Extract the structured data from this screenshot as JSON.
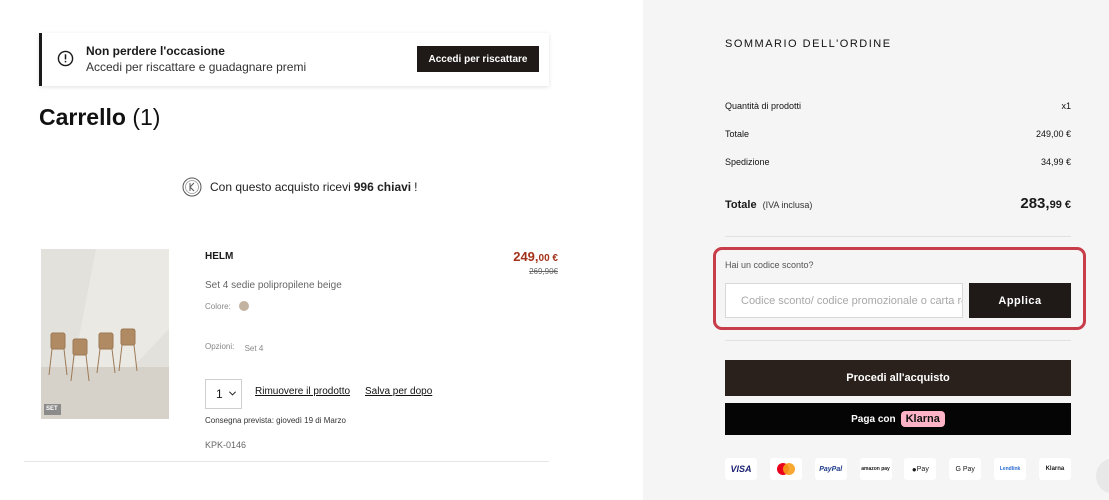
{
  "banner": {
    "title": "Non perdere l'occasione",
    "subtitle": "Accedi per riscattare e guadagnare premi",
    "button": "Accedi per riscattare",
    "icon": "info-icon"
  },
  "cart": {
    "title": "Carrello",
    "count": "(1)"
  },
  "keys": {
    "prefix": "Con questo acquisto ricevi",
    "amount": "996 chiavi",
    "suffix": "!",
    "icon": "keys-coin-icon"
  },
  "product": {
    "badge": "SET",
    "name": "HELM",
    "description": "Set 4 sedie polipropilene beige",
    "color_label": "Colore:",
    "color_value": "#c2b29f",
    "options_label": "Opzioni:",
    "options_value": "Set 4",
    "quantity": "1",
    "remove_label": "Rimuovere il prodotto",
    "save_label": "Salva per dopo",
    "delivery": "Consegna prevista: giovedì 19 di Marzo",
    "sku": "KPK-0146",
    "price_int": "249,",
    "price_dec": "00 €",
    "price_old": "269,90€",
    "price_color": "#a3321b"
  },
  "summary": {
    "title": "SOMMARIO DELL'ORDINE",
    "rows": [
      {
        "label": "Quantità di prodotti",
        "value": "x1"
      },
      {
        "label": "Totale",
        "value": "249,00 €"
      },
      {
        "label": "Spedizione",
        "value": "34,99 €"
      }
    ],
    "total_label": "Totale",
    "total_note": "(IVA inclusa)",
    "total_int": "283,",
    "total_dec": "99 €"
  },
  "promo": {
    "label": "Hai un codice sconto?",
    "placeholder": "Codice sconto/ codice promozionale o carta regalo",
    "value": "",
    "button": "Applica",
    "highlight_color": "#c83d4a"
  },
  "checkout": {
    "primary": "Procedi all'acquisto",
    "klarna_prefix": "Paga con",
    "klarna_badge": "Klarna"
  },
  "payments": [
    "VISA",
    "Mastercard",
    "PayPal",
    "amazon pay",
    "Pay",
    "G Pay",
    "Lendlink",
    "Klarna"
  ]
}
